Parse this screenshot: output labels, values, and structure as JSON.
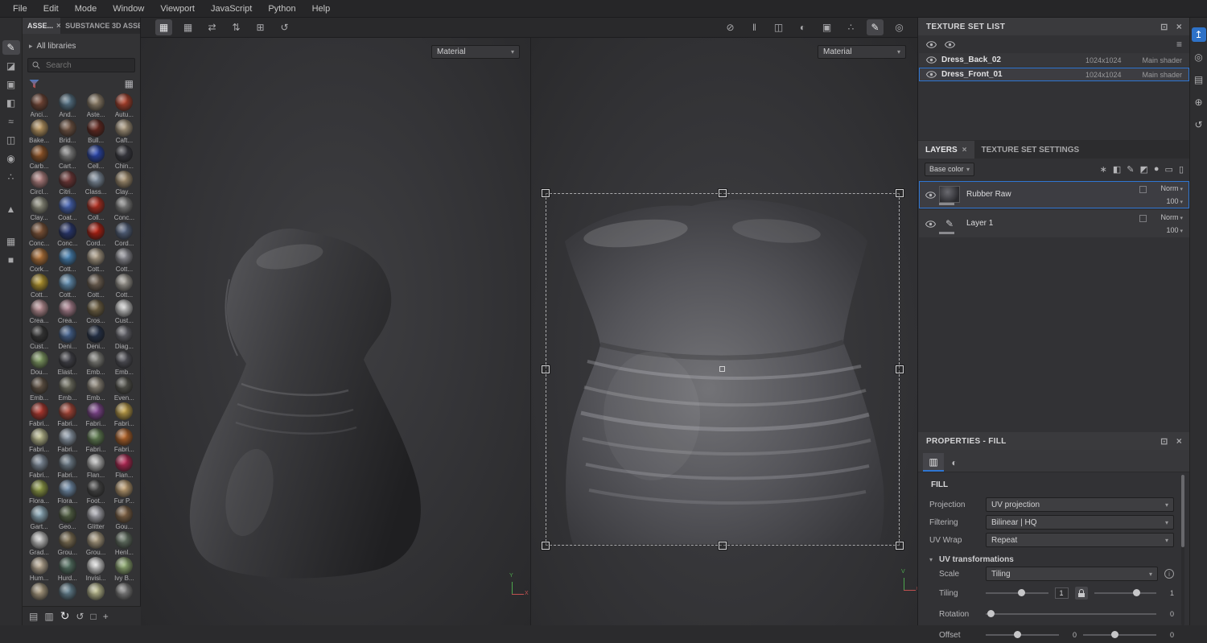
{
  "menubar": {
    "items": [
      "File",
      "Edit",
      "Mode",
      "Window",
      "Viewport",
      "JavaScript",
      "Python",
      "Help"
    ]
  },
  "accent_color": "#2f76d2",
  "toolbars": {
    "left_tools": [
      {
        "name": "paint-brush-tool-icon",
        "glyph": "✎",
        "active": true
      },
      {
        "name": "eraser-tool-icon",
        "glyph": "◪"
      },
      {
        "name": "projection-tool-icon",
        "glyph": "▣"
      },
      {
        "name": "polygon-fill-tool-icon",
        "glyph": "◧"
      },
      {
        "name": "smudge-tool-icon",
        "glyph": "≈"
      },
      {
        "name": "clone-tool-icon",
        "glyph": "◫"
      },
      {
        "name": "material-picker-tool-icon",
        "glyph": "◉"
      },
      {
        "name": "particles-tool-icon",
        "glyph": "∴"
      },
      {
        "divider": true
      },
      {
        "name": "geometry-mask-icon",
        "glyph": "▲"
      },
      {
        "divider": true
      },
      {
        "name": "uv-chunk-fill-icon",
        "glyph": "▦"
      },
      {
        "name": "object-fill-icon",
        "glyph": "■"
      }
    ],
    "viewport_left": [
      {
        "name": "snap-grid-icon",
        "glyph": "▦",
        "active": true
      },
      {
        "name": "tile-view-icon",
        "glyph": "▦"
      },
      {
        "name": "symmetry-x-icon",
        "glyph": "⇄"
      },
      {
        "name": "symmetry-y-icon",
        "glyph": "⇅"
      },
      {
        "name": "add-frame-icon",
        "glyph": "⊞"
      },
      {
        "name": "history-icon",
        "glyph": "↺"
      }
    ],
    "viewport_right": [
      {
        "name": "hide-ui-eye-icon",
        "glyph": "⊘"
      },
      {
        "name": "pause-engine-icon",
        "glyph": "‖"
      },
      {
        "name": "split-view-icon",
        "glyph": "◫"
      },
      {
        "name": "material-sphere-icon",
        "glyph": "◐"
      },
      {
        "name": "camera-frame-icon",
        "glyph": "▣"
      },
      {
        "name": "spray-icon",
        "glyph": "∴"
      },
      {
        "name": "pencil-icon",
        "glyph": "✎",
        "active": true
      },
      {
        "name": "camera-icon",
        "glyph": "◎"
      }
    ],
    "assets_bottom": [
      {
        "name": "import-resources-icon",
        "glyph": "▤"
      },
      {
        "name": "details-view-icon",
        "glyph": "▥"
      },
      {
        "name": "refresh-shelf-icon",
        "glyph": "↻",
        "active": true
      },
      {
        "name": "shelf-history-icon",
        "glyph": "↺"
      },
      {
        "name": "frame-icon",
        "glyph": "□"
      },
      {
        "name": "add-icon",
        "glyph": "+"
      }
    ],
    "layer_actions": [
      {
        "name": "add-effect-icon",
        "glyph": "∗"
      },
      {
        "name": "add-mask-icon",
        "glyph": "◧"
      },
      {
        "name": "add-paint-layer-icon",
        "glyph": "✎"
      },
      {
        "name": "add-fill-layer-icon",
        "glyph": "◩"
      },
      {
        "name": "add-smart-material-icon",
        "glyph": "●"
      },
      {
        "name": "add-folder-icon",
        "glyph": "▭"
      },
      {
        "name": "delete-layer-icon",
        "glyph": "▯"
      }
    ],
    "far_right": [
      {
        "name": "share-export-icon",
        "glyph": "↥",
        "accent": true
      },
      {
        "name": "display-camera-icon",
        "glyph": "◎"
      },
      {
        "name": "pages-icon",
        "glyph": "▤"
      },
      {
        "name": "web-globe-icon",
        "glyph": "⊕"
      },
      {
        "name": "history-clock-icon",
        "glyph": "↺"
      }
    ]
  },
  "assets": {
    "tab1": "ASSE...",
    "tab2": "SUBSTANCE 3D ASSE...",
    "library": "All libraries",
    "search_placeholder": "Search",
    "items": [
      {
        "label": "Anci...",
        "color": "#7c4a38"
      },
      {
        "label": "And...",
        "color": "#5d7d92"
      },
      {
        "label": "Aste...",
        "color": "#9b8a72"
      },
      {
        "label": "Autu...",
        "color": "#b8432c"
      },
      {
        "label": "Bake...",
        "color": "#c9a368"
      },
      {
        "label": "Brid...",
        "color": "#7a5a47"
      },
      {
        "label": "Bull...",
        "color": "#6e2a20"
      },
      {
        "label": "Caft...",
        "color": "#b4a286"
      },
      {
        "label": "Carb...",
        "color": "#9c5a28"
      },
      {
        "label": "Cart...",
        "color": "#8d8d8d"
      },
      {
        "label": "Cell...",
        "color": "#2a49b8"
      },
      {
        "label": "Chin...",
        "color": "#3c3c44"
      },
      {
        "label": "Circl...",
        "color": "#c08a8a"
      },
      {
        "label": "Citri...",
        "color": "#7a3a3a"
      },
      {
        "label": "Class...",
        "color": "#8a9aac"
      },
      {
        "label": "Clay...",
        "color": "#b09a78"
      },
      {
        "label": "Clay...",
        "color": "#9a9a88"
      },
      {
        "label": "Coat...",
        "color": "#4a6ac0"
      },
      {
        "label": "Coll...",
        "color": "#c03020"
      },
      {
        "label": "Conc...",
        "color": "#8a8a8a"
      },
      {
        "label": "Conc...",
        "color": "#8a5a3a"
      },
      {
        "label": "Conc...",
        "color": "#2a3a7a"
      },
      {
        "label": "Cord...",
        "color": "#c02010"
      },
      {
        "label": "Cord...",
        "color": "#5a6a88"
      },
      {
        "label": "Cork...",
        "color": "#c07a3a"
      },
      {
        "label": "Cott...",
        "color": "#4a8ac0"
      },
      {
        "label": "Cott...",
        "color": "#b8a890"
      },
      {
        "label": "Cott...",
        "color": "#9a9aa2"
      },
      {
        "label": "Cott...",
        "color": "#c0a030"
      },
      {
        "label": "Cott...",
        "color": "#6a9ac0"
      },
      {
        "label": "Cott...",
        "color": "#7a6a5a"
      },
      {
        "label": "Cott...",
        "color": "#aaa69e"
      },
      {
        "label": "Crea...",
        "color": "#c89aa0"
      },
      {
        "label": "Crea...",
        "color": "#b88a9a"
      },
      {
        "label": "Cros...",
        "color": "#7a6a48"
      },
      {
        "label": "Cust...",
        "color": "#d8d8d8"
      },
      {
        "label": "Cust...",
        "color": "#3a3a3a"
      },
      {
        "label": "Deni...",
        "color": "#4a6a9a"
      },
      {
        "label": "Deni...",
        "color": "#26344e"
      },
      {
        "label": "Diag...",
        "color": "#6a6a72"
      },
      {
        "label": "Dou...",
        "color": "#8aa86a"
      },
      {
        "label": "Elast...",
        "color": "#46464e"
      },
      {
        "label": "Emb...",
        "color": "#8a8a84"
      },
      {
        "label": "Emb...",
        "color": "#55555d"
      },
      {
        "label": "Emb...",
        "color": "#6a5a4a"
      },
      {
        "label": "Emb...",
        "color": "#7a7a6a"
      },
      {
        "label": "Emb...",
        "color": "#9a9284"
      },
      {
        "label": "Even...",
        "color": "#5a5a52"
      },
      {
        "label": "Fabri...",
        "color": "#c03a30"
      },
      {
        "label": "Fabri...",
        "color": "#b84a3a"
      },
      {
        "label": "Fabri...",
        "color": "#8a4a9a"
      },
      {
        "label": "Fabri...",
        "color": "#caa84a"
      },
      {
        "label": "Fabri...",
        "color": "#caca9a"
      },
      {
        "label": "Fabri...",
        "color": "#9aa8b8"
      },
      {
        "label": "Fabri...",
        "color": "#6a8a5a"
      },
      {
        "label": "Fabri...",
        "color": "#c06a2a"
      },
      {
        "label": "Fabri...",
        "color": "#8a98a8"
      },
      {
        "label": "Fabri...",
        "color": "#7a8a98"
      },
      {
        "label": "Flan...",
        "color": "#c8c8c8"
      },
      {
        "label": "Flan...",
        "color": "#c02858"
      },
      {
        "label": "Flora...",
        "color": "#9aa84a"
      },
      {
        "label": "Flora...",
        "color": "#7a98b8"
      },
      {
        "label": "Foot...",
        "color": "#4a4a4a"
      },
      {
        "label": "Fur P...",
        "color": "#caa878"
      },
      {
        "label": "Gart...",
        "color": "#98b8c8"
      },
      {
        "label": "Geo...",
        "color": "#5a6a4a"
      },
      {
        "label": "Glitter",
        "color": "#b8b8c0"
      },
      {
        "label": "Gou...",
        "color": "#8a6a4a"
      },
      {
        "label": "Grad...",
        "color": "#d8d8d8"
      },
      {
        "label": "Grou...",
        "color": "#8a7a5a"
      },
      {
        "label": "Grou...",
        "color": "#b8a88a"
      },
      {
        "label": "Henl...",
        "color": "#6a7a6a"
      },
      {
        "label": "Hum...",
        "color": "#c8b8a0"
      },
      {
        "label": "Hurd...",
        "color": "#5a7a6a"
      },
      {
        "label": "Invisi...",
        "color": "#e8e8e8"
      },
      {
        "label": "Ivy B...",
        "color": "#9ab87a"
      },
      {
        "label": "",
        "color": "#b8a88a"
      },
      {
        "label": "",
        "color": "#6a8a9a"
      },
      {
        "label": "",
        "color": "#caca9a"
      },
      {
        "label": "",
        "color": "#8a8a8a"
      }
    ]
  },
  "viewport3d": {
    "material_label": "Material",
    "axis_up": "Y",
    "axis_right": "X"
  },
  "viewport2d": {
    "material_label": "Material",
    "axis_up": "V",
    "axis_right": "U"
  },
  "texture_set_list": {
    "title": "TEXTURE SET LIST",
    "rows": [
      {
        "name": "Dress_Back_02",
        "size": "1024x1024",
        "shader": "Main shader",
        "selected": false
      },
      {
        "name": "Dress_Front_01",
        "size": "1024x1024",
        "shader": "Main shader",
        "selected": true
      }
    ]
  },
  "layers_panel": {
    "tab_layers": "LAYERS",
    "tab_settings": "TEXTURE SET SETTINGS",
    "channel": "Base color",
    "layers": [
      {
        "name": "Rubber Raw",
        "blend": "Norm",
        "opacity": "100",
        "selected": true,
        "thumb": "image"
      },
      {
        "name": "Layer 1",
        "blend": "Norm",
        "opacity": "100",
        "selected": false,
        "thumb": "brush"
      }
    ]
  },
  "properties": {
    "title": "PROPERTIES - FILL",
    "section": "FILL",
    "projection_label": "Projection",
    "projection_value": "UV projection",
    "filtering_label": "Filtering",
    "filtering_value": "Bilinear | HQ",
    "uvwrap_label": "UV Wrap",
    "uvwrap_value": "Repeat",
    "uv_transforms_label": "UV transformations",
    "scale_label": "Scale",
    "scale_value": "Tiling",
    "tiling_label": "Tiling",
    "tiling_value": "1",
    "tiling_value2": "1",
    "rotation_label": "Rotation",
    "rotation_value": "0",
    "offset_label": "Offset",
    "offset_value": "0",
    "offset_value2": "0"
  }
}
